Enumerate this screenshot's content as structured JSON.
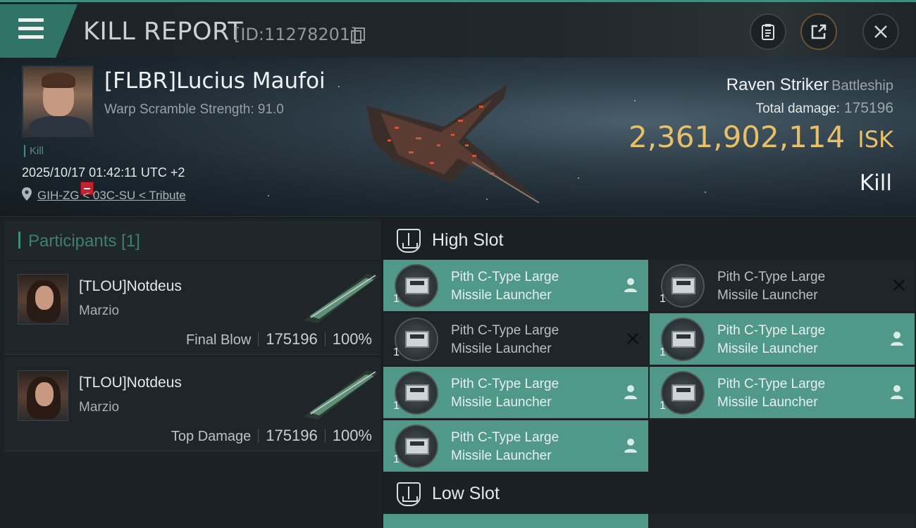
{
  "header": {
    "title": "KILL REPORT",
    "report_id": "[ID:11278201]",
    "icons": [
      "menu-icon",
      "copy-icon",
      "clipboard-icon",
      "share-icon",
      "close-icon"
    ]
  },
  "victim": {
    "name": "[FLBR]Lucius Maufoi",
    "warp_scramble": "Warp Scramble Strength: 91.0",
    "tag": "Kill",
    "timestamp": "2025/10/17 01:42:11 UTC +2",
    "location": "GIH-ZG < 03C-SU < Tribute",
    "ship_name": "Raven Striker",
    "ship_class": "Battleship",
    "total_damage_label": "Total damage:",
    "total_damage": "175196",
    "isk_value": "2,361,902,114",
    "isk_unit": "ISK",
    "result": "Kill"
  },
  "participants": {
    "title": "Participants [1]",
    "rows": [
      {
        "name": "[TLOU]Notdeus",
        "sub": "Marzio",
        "role": "Final Blow",
        "damage": "175196",
        "percent": "100%"
      },
      {
        "name": "[TLOU]Notdeus",
        "sub": "Marzio",
        "role": "Top Damage",
        "damage": "175196",
        "percent": "100%"
      }
    ]
  },
  "fitting": {
    "high_slot_title": "High Slot",
    "low_slot_title": "Low Slot",
    "high_slot": [
      {
        "line1": "Pith C-Type Large",
        "line2": "Missile Launcher",
        "qty": "1",
        "state": "fitted"
      },
      {
        "line1": "Pith C-Type Large",
        "line2": "Missile Launcher",
        "qty": "1",
        "state": "destroyed"
      },
      {
        "line1": "Pith C-Type Large",
        "line2": "Missile Launcher",
        "qty": "1",
        "state": "destroyed"
      },
      {
        "line1": "Pith C-Type Large",
        "line2": "Missile Launcher",
        "qty": "1",
        "state": "fitted"
      },
      {
        "line1": "Pith C-Type Large",
        "line2": "Missile Launcher",
        "qty": "1",
        "state": "fitted"
      },
      {
        "line1": "Pith C-Type Large",
        "line2": "Missile Launcher",
        "qty": "1",
        "state": "fitted"
      },
      {
        "line1": "Pith C-Type Large",
        "line2": "Missile Launcher",
        "qty": "1",
        "state": "fitted"
      }
    ]
  },
  "colors": {
    "accent_teal": "#4f988a",
    "isk_gold": "#e8c06a",
    "badge_red": "#c42230"
  }
}
